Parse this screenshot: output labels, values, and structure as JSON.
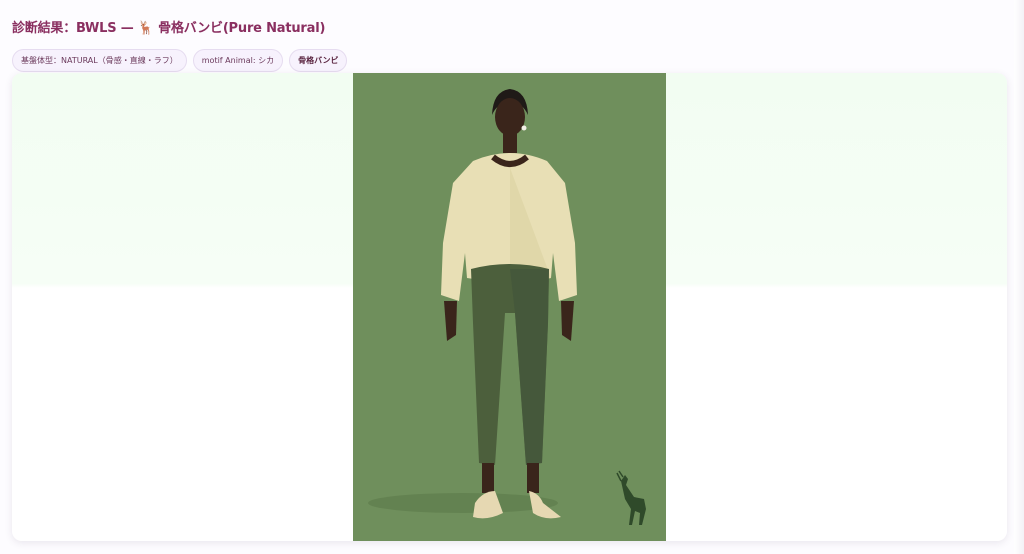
{
  "header": {
    "title_prefix": "診断結果：BWLS — ",
    "title_emoji": "🦌",
    "title_suffix": " 骨格バンビ(Pure Natural)"
  },
  "chips": [
    {
      "label": "基盤体型：NATURAL（骨感・直線・ラフ）"
    },
    {
      "label": "motif Animal: シカ"
    },
    {
      "label": "骨格バンビ"
    }
  ],
  "colors": {
    "title": "#8a2f60",
    "illustration_background": "#6e8f5a",
    "sweater": "#e8dfb5",
    "pants": "#4c5f3c"
  },
  "icons": {
    "title_icon": "deer-emoji",
    "motif_icon": "deer-silhouette-icon"
  }
}
